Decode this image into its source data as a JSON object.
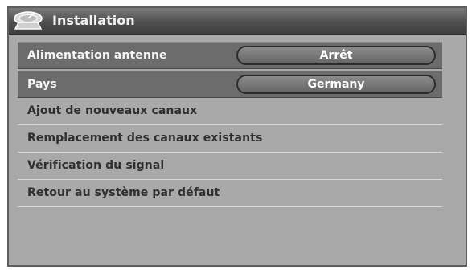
{
  "window": {
    "title": "Installation",
    "icon": "satellite-dish-icon"
  },
  "menu": {
    "items": [
      {
        "label": "Alimentation antenne",
        "value": "Arrêt"
      },
      {
        "label": "Pays",
        "value": "Germany"
      },
      {
        "label": "Ajout de nouveaux canaux"
      },
      {
        "label": "Remplacement des canaux existants"
      },
      {
        "label": "Vérification du signal"
      },
      {
        "label": "Retour au système par défaut"
      }
    ]
  }
}
